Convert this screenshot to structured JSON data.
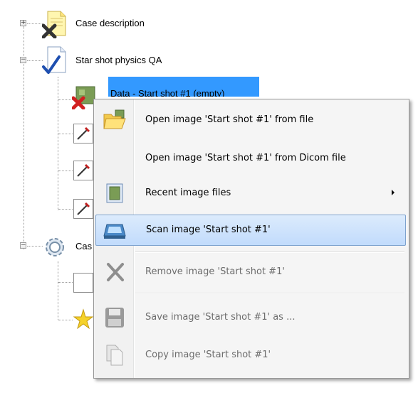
{
  "tree": {
    "nodes": [
      {
        "label": "Case description",
        "icon": "document-x-icon",
        "expanded": false
      },
      {
        "label": "Star shot physics QA",
        "icon": "checked-document-icon",
        "expanded": true
      },
      {
        "label": "Data - Start shot #1 (empty)",
        "icon": "image-missing-icon",
        "selected": true
      },
      {
        "label": "Cas",
        "icon": "gear-icon",
        "expanded": true
      }
    ]
  },
  "context_menu": {
    "items": [
      {
        "label": "Open image 'Start shot #1' from file",
        "icon": "folder-open-icon",
        "enabled": true
      },
      {
        "label": "Open image 'Start shot #1' from Dicom file",
        "icon": "",
        "enabled": true
      },
      {
        "label": "Recent image files",
        "icon": "recent-image-icon",
        "enabled": true,
        "submenu": true
      },
      {
        "label": "Scan image 'Start shot #1'",
        "icon": "scanner-icon",
        "enabled": true,
        "highlighted": true
      },
      {
        "label": "Remove image 'Start shot #1'",
        "icon": "remove-x-icon",
        "enabled": false
      },
      {
        "label": "Save image 'Start shot #1' as ...",
        "icon": "floppy-disk-icon",
        "enabled": false
      },
      {
        "label": "Copy image 'Start shot #1'",
        "icon": "copy-icon",
        "enabled": false
      }
    ]
  }
}
